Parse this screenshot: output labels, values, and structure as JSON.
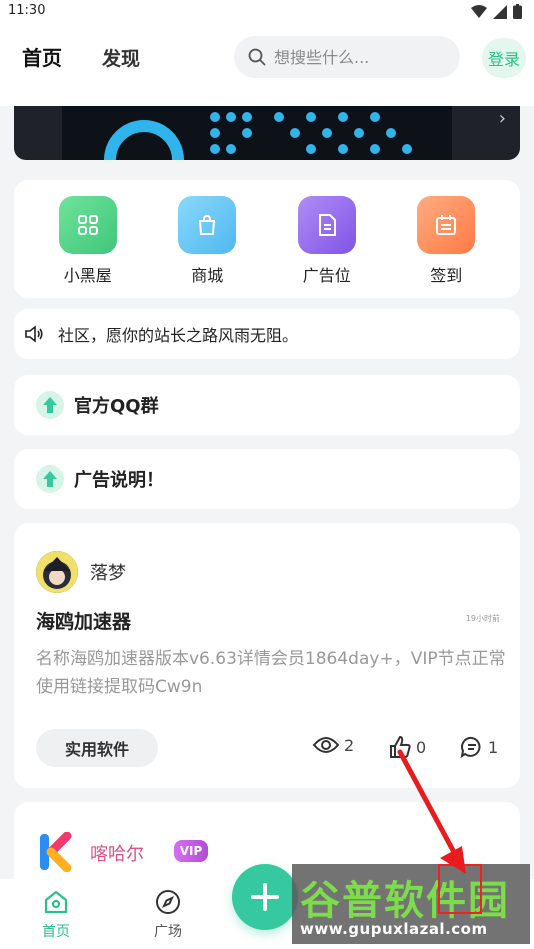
{
  "status": {
    "time": "11:30"
  },
  "header": {
    "tabs": [
      {
        "label": "首页"
      },
      {
        "label": "发现"
      }
    ],
    "search_placeholder": "想搜些什么...",
    "login_label": "登录"
  },
  "quick_links": [
    {
      "label": "小黑屋",
      "icon": "grid-icon",
      "color": "#53d48a"
    },
    {
      "label": "商城",
      "icon": "shopping-bag-icon",
      "color": "#5cc4f5"
    },
    {
      "label": "广告位",
      "icon": "document-icon",
      "color": "#9a6af0"
    },
    {
      "label": "签到",
      "icon": "calendar-icon",
      "color": "#ff8a5c"
    }
  ],
  "notice": {
    "text": "社区，愿你的站长之路风雨无阻。"
  },
  "link_cards": [
    {
      "label": "官方QQ群"
    },
    {
      "label": "广告说明！"
    }
  ],
  "post": {
    "author": "落梦",
    "title": "海鸥加速器",
    "time": "19小时前",
    "body": "名称海鸥加速器版本v6.63详情会员1864day+，VIP节点正常使用链接提取码Cw9n",
    "tag": "实用软件",
    "views": "2",
    "likes": "0",
    "comments": "1"
  },
  "post2": {
    "author": "喀哈尔",
    "badge": "VIP"
  },
  "tabbar": [
    {
      "label": "首页",
      "active": true
    },
    {
      "label": "广场",
      "active": false
    }
  ],
  "watermark": {
    "brand": "谷普软件园",
    "url": "www.gupuxlazal.com"
  },
  "accent_color": "#36c9a0"
}
